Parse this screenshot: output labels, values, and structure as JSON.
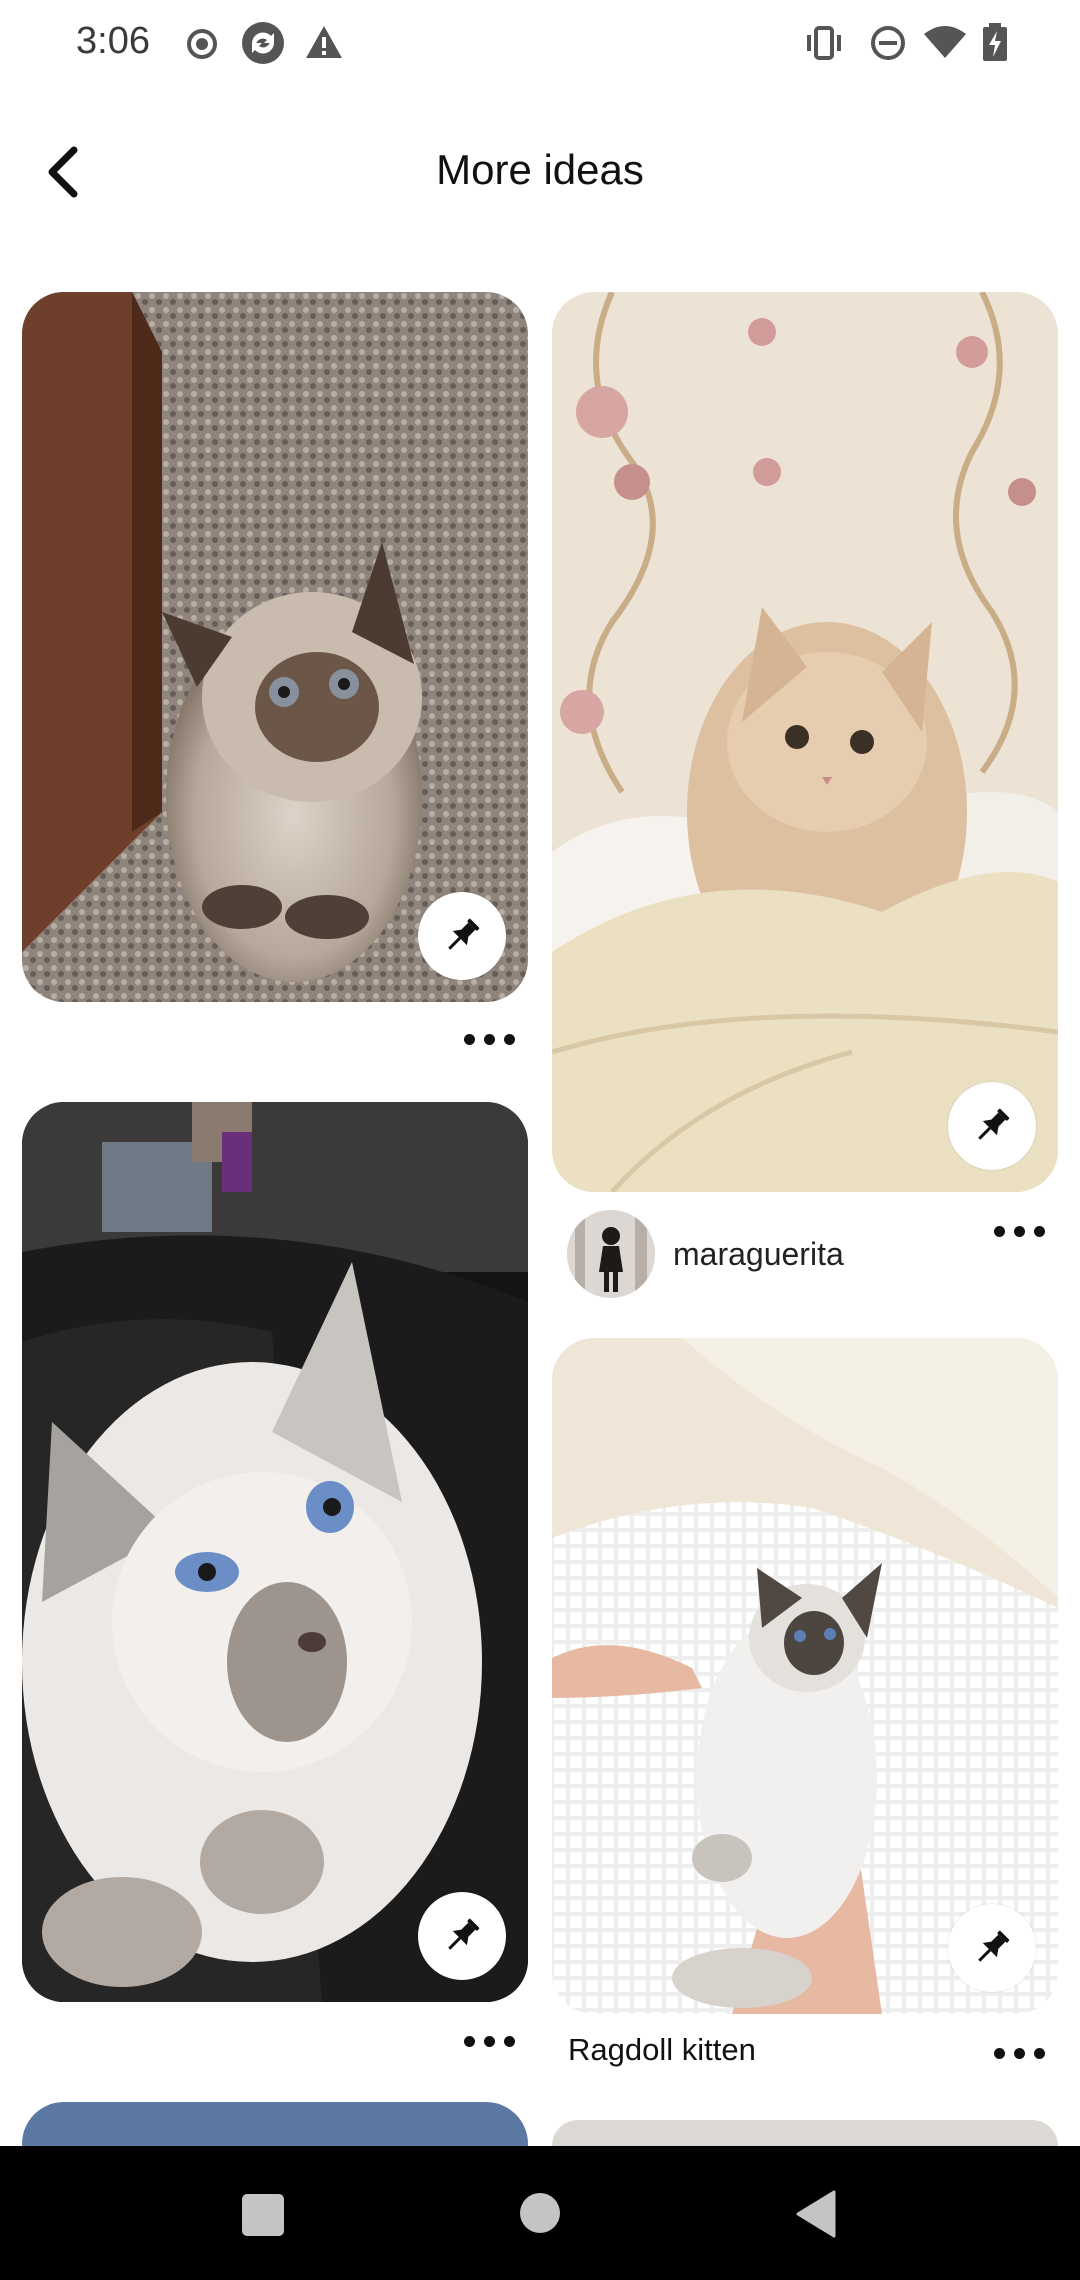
{
  "status_bar": {
    "time": "3:06",
    "left_icons": [
      "radio-button-icon",
      "sync-icon",
      "warning-icon"
    ],
    "right_icons": [
      "vibrate-icon",
      "do-not-disturb-icon",
      "wifi-icon",
      "battery-charging-icon"
    ]
  },
  "header": {
    "back_icon": "chevron-left-icon",
    "title": "More ideas"
  },
  "pins": [
    {
      "id": "pin-1",
      "image": "fluffy seal-point kitten sitting on carpet",
      "save_icon": "pushpin-icon",
      "more_icon": "ellipsis-icon",
      "title": "",
      "creator": ""
    },
    {
      "id": "pin-2",
      "image": "cream fluffy kitten lying on pillow",
      "save_icon": "pushpin-icon",
      "more_icon": "ellipsis-icon",
      "title": "",
      "creator": "maraguerita"
    },
    {
      "id": "pin-3",
      "image": "white blue-eyed birman cat on black leather",
      "save_icon": "pushpin-icon",
      "more_icon": "ellipsis-icon",
      "title": "",
      "creator": ""
    },
    {
      "id": "pin-4",
      "image": "ragdoll kitten held on white blanket",
      "save_icon": "pushpin-icon",
      "more_icon": "ellipsis-icon",
      "title": "Ragdoll kitten",
      "creator": ""
    }
  ],
  "nav_bar": {
    "buttons": [
      "recents-square-icon",
      "home-circle-icon",
      "back-triangle-icon"
    ]
  },
  "colors": {
    "background": "#ffffff",
    "text": "#111111",
    "nav_bar": "#000000",
    "status_icons": "#555555"
  }
}
